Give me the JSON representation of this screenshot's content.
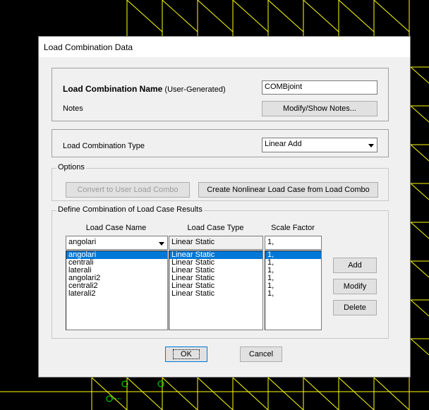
{
  "dialog": {
    "title": "Load Combination Data"
  },
  "name_section": {
    "name_label": "Load Combination Name",
    "name_suffix": "(User-Generated)",
    "name_value": "COMBjoint",
    "notes_label": "Notes",
    "notes_button": "Modify/Show Notes..."
  },
  "type_section": {
    "label": "Load Combination Type",
    "selected": "Linear Add"
  },
  "options": {
    "legend": "Options",
    "convert_button": "Convert to User Load Combo",
    "create_button": "Create Nonlinear Load Case from Load Combo"
  },
  "define": {
    "legend": "Define Combination of Load Case Results",
    "columns": [
      "Load Case Name",
      "Load Case Type",
      "Scale Factor"
    ],
    "current": {
      "name": "angolari",
      "type": "Linear Static",
      "factor": "1,"
    },
    "rows": [
      {
        "name": "angolari",
        "type": "Linear Static",
        "factor": "1,"
      },
      {
        "name": "centrali",
        "type": "Linear Static",
        "factor": "1,"
      },
      {
        "name": "laterali",
        "type": "Linear Static",
        "factor": "1,"
      },
      {
        "name": "angolari2",
        "type": "Linear Static",
        "factor": "1,"
      },
      {
        "name": "centrali2",
        "type": "Linear Static",
        "factor": "1,"
      },
      {
        "name": "laterali2",
        "type": "Linear Static",
        "factor": "1,"
      }
    ],
    "selected_index": 0,
    "add_button": "Add",
    "modify_button": "Modify",
    "delete_button": "Delete"
  },
  "footer": {
    "ok_button": "OK",
    "cancel_button": "Cancel"
  },
  "colors": {
    "background": "#000000",
    "grid": "#ffff00",
    "selection": "#0078d7",
    "marker": "#00ff00"
  }
}
